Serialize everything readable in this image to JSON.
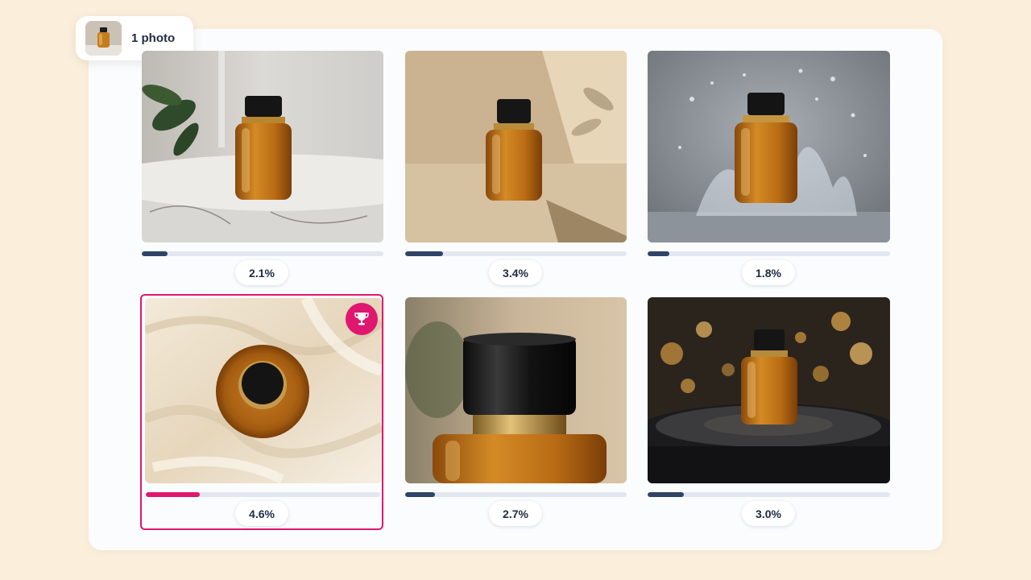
{
  "chip": {
    "label": "1 photo"
  },
  "variants": [
    {
      "percent_label": "2.1%",
      "percent": 2.1,
      "winner": false
    },
    {
      "percent_label": "3.4%",
      "percent": 3.4,
      "winner": false
    },
    {
      "percent_label": "1.8%",
      "percent": 1.8,
      "winner": false
    },
    {
      "percent_label": "4.6%",
      "percent": 4.6,
      "winner": true
    },
    {
      "percent_label": "2.7%",
      "percent": 2.7,
      "winner": false
    },
    {
      "percent_label": "3.0%",
      "percent": 3.0,
      "winner": false
    }
  ],
  "colors": {
    "accent": "#e0176f",
    "bar": "#2f4466",
    "track": "#e2e7f0",
    "background": "#fbefdc"
  },
  "icons": {
    "winner": "trophy-icon"
  }
}
